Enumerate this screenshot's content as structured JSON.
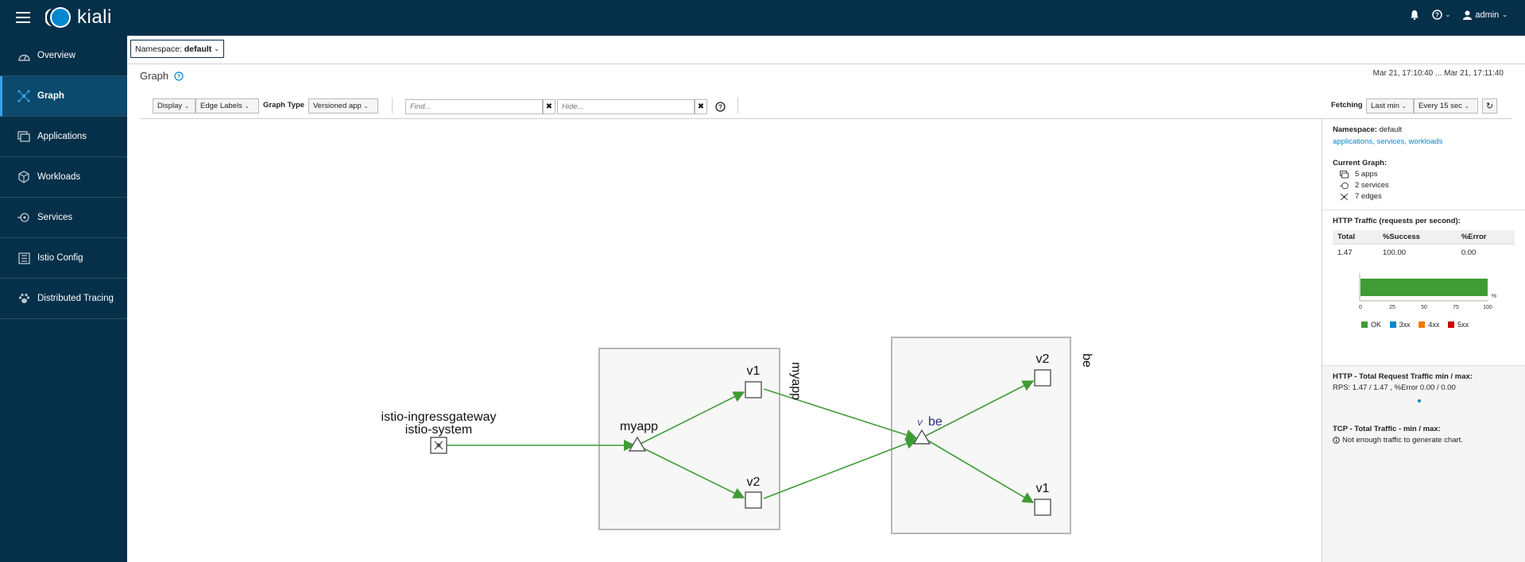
{
  "header": {
    "brand": "kiali",
    "user": "admin"
  },
  "sidebar": {
    "items": [
      {
        "label": "Overview",
        "icon": "overview-icon"
      },
      {
        "label": "Graph",
        "icon": "graph-icon"
      },
      {
        "label": "Applications",
        "icon": "applications-icon"
      },
      {
        "label": "Workloads",
        "icon": "workloads-icon"
      },
      {
        "label": "Services",
        "icon": "services-icon"
      },
      {
        "label": "Istio Config",
        "icon": "istio-config-icon"
      },
      {
        "label": "Distributed Tracing",
        "icon": "tracing-icon"
      }
    ],
    "active": "Graph"
  },
  "namespace_bar": {
    "label": "Namespace:",
    "value": "default"
  },
  "page": {
    "title": "Graph",
    "date_range": "Mar 21, 17:10:40 ... Mar 21, 17:11:40"
  },
  "toolbar": {
    "display": "Display",
    "edge_labels": "Edge Labels",
    "graph_type_label": "Graph Type",
    "graph_type_value": "Versioned app",
    "find_placeholder": "Find...",
    "hide_placeholder": "Hide...",
    "fetching_label": "Fetching",
    "duration": "Last min",
    "refresh": "Every 15 sec"
  },
  "graph": {
    "nodes": {
      "ingress_name": "istio-ingressgateway",
      "ingress_ns": "istio-system",
      "myapp_box": "myapp",
      "myapp_app": "myapp",
      "myapp_v1": "v1",
      "myapp_v2": "v2",
      "be_box": "be",
      "be_app": "be",
      "be_v1": "v1",
      "be_v2": "v2"
    },
    "edge_color": "#3f9c35"
  },
  "side_panel": {
    "namespace_label": "Namespace:",
    "namespace_value": "default",
    "links": "applications, services, workloads",
    "current_graph_label": "Current Graph:",
    "apps": "5 apps",
    "services": "2 services",
    "edges": "7 edges",
    "http_traffic_title": "HTTP Traffic (requests per second):",
    "table_headers": [
      "Total",
      "%Success",
      "%Error"
    ],
    "table_row": [
      "1.47",
      "100.00",
      "0.00"
    ],
    "bar_ticks": [
      "0",
      "25",
      "50",
      "75",
      "100"
    ],
    "bar_unit": "%",
    "bar_ok_percent": 100,
    "legend": [
      {
        "label": "OK",
        "color": "#3f9c35"
      },
      {
        "label": "3xx",
        "color": "#0088ce"
      },
      {
        "label": "4xx",
        "color": "#ec7a08"
      },
      {
        "label": "5xx",
        "color": "#cc0000"
      }
    ],
    "http_total_title": "HTTP - Total Request Traffic min / max:",
    "http_total_value": "RPS: 1.47 / 1.47 , %Error 0.00 / 0.00",
    "tcp_title": "TCP - Total Traffic - min / max:",
    "tcp_value": "Not enough traffic to generate chart."
  }
}
